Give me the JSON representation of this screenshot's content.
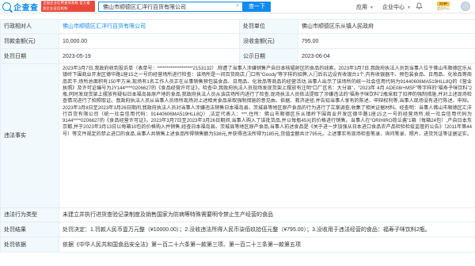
{
  "header": {
    "logo_text": "企查查",
    "promo_text": "全国企业信用查询系统 官方备案企业征信机构",
    "search_value": "佛山市顺德区汇洋行百货有限公司",
    "search_clear": "✕",
    "search_button": "查一下",
    "nav_app": "应用",
    "nav_enterprise": "企业中心",
    "svip_label": "SVIP",
    "svip_sub": "会员中心",
    "brand_color": "#128bed"
  },
  "record": {
    "row1": {
      "label_left": "行政相对人",
      "value_left": "佛山市顺德区汇洋行百货有限公司",
      "label_right": "处罚单位",
      "value_right": "佛山市顺德区乐从镇人民政府"
    },
    "row2": {
      "label_left": "罚款金额(元)",
      "value_left": "10,000.00",
      "label_right": "没收金额(元)",
      "value_right": "795.00"
    },
    "row3": {
      "label_left": "处罚日期",
      "value_left": "2023-05-19",
      "label_right": "公示日期",
      "value_right": "2023-06-04"
    },
    "row4": {
      "label": "违法事实",
      "text": "2023年3月7日,我政府收到投诉单（表单号：*******************2153132）,称遭了当事人涉嫌销售产自日本核辐射区的食品的线索。2023年3月7日,我政府执法人员到当事人位于佛山市顺德区乐从镇岭下围商业开发区德华路1座15之一号的经营场所进行检查：该场所是一间百货商店,门口有“Goody”等字样的招牌,入门后右边设有收银台1个,内有收银器干、预包装食品、日用品、化妆品等商品若干,场所总面积有150平方米,现场有1名工作人员正在从事销售预包装食品、日用品、化妆品等商品的经营活动,当事人出示了该场所的统一社会信用代码为91440606MA519HLL8Q的《营业执照》及许可证编号为JY144****0206627的《食品经营许可证》。检查中,我政府执法人员现场发现货架上摆放有注明“口厂区名：大分县”、“2023年 4月 ADE08/+MSF”等字样的“福寿子咪饮料”2瓶,同时发现货架上摆放有疑似日本福岛县原产地的食品,我政府执法人员从该店场所内进行了检查,现场执法人员依法提取了涉嫌违法的“福寿子咪饮料”2瓶采取了扣押的强制措施,并对上述现场检查情况进行了拍照取证。我政府执法人员从当事人员场所现场对上述相关食品采取强制措施的意见由、依据、救济途径,并告知当事人享有的陈述、申辩权利等,当事人现场没有进行陈述、申辩。2023年3月8日至2023年3月26日期间,我政府执法人员对当事人涉嫌违法销售日本福岛县、茨城县等地区原产食品的行为进行了立案调查,收集了相关证据材料。经查明：当事人佛山市顺德区汇洋行百货有限公司（统一社会信用代码：91440606MA519HLL8Q）,法定代表人：***,住所：佛山市顺德区乐从镇岭下围商业开发区德华路1座15之一号的经营场所,统一社会信用代码为9144****0206627的《食品经营许可证》。2023年3月7日至2023年3月26日期间,当事人购入了该批货品,并以每瓶45元的价格进行销售。当事人在“ORIHIRO荷兰酱”1箱（每箱24包）,产自日本东京都,并于2023年3月13日以每箱10包的价格购入并销售,经查日本福岛县、茨城县等地区原产食品,当事人前述食品是《关于进一步加强从日本进口食品农产品检验检疫监管的公告》（2011年第44号）等文件规定的禁止进口的食品,当事人共销售上述食品所得销售额为538元,并获得违法所得为185元,货值金额共计795元。上述事实有现场检查笔录、询问笔录、照片、进货凭证等证据证实。"
    },
    "row5": {
      "label": "违法行为类型",
      "value": "未建立并执行进货查验记录制度及销售国家为防病等特殊需要明令禁止生产经营的食品"
    },
    "row6": {
      "label": "处罚结果",
      "value": "处罚决定：1.罚款人民币壹万元整（¥10000.00）；2.没收违法所得人民币柒佰玖拾伍元整（¥795.00）；3.没收用于违法经营的食品：福寿子咪饮料2瓶。"
    },
    "row7": {
      "label": "处罚依据",
      "value": "依据《中华人民共和国食品安全法》第一百二十六条第一款第三项、第一百二十三条第一款第五项"
    }
  }
}
